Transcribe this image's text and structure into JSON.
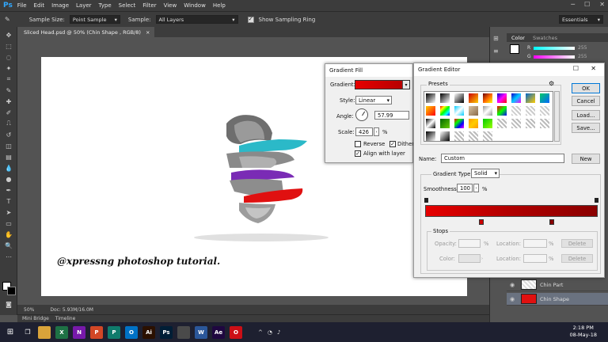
{
  "menubar": {
    "app_logo": "Ps",
    "items": [
      "File",
      "Edit",
      "Image",
      "Layer",
      "Type",
      "Select",
      "Filter",
      "View",
      "Window",
      "Help"
    ]
  },
  "options": {
    "sample_size_label": "Sample Size:",
    "sample_size_value": "Point Sample",
    "sample_label": "Sample:",
    "sample_value": "All Layers",
    "show_ring_label": "Show Sampling Ring",
    "workspace": "Essentials"
  },
  "document": {
    "tab_title": "Sliced Head.psd @ 50% (Chin Shape , RGB/8)",
    "zoom": "50%",
    "doc_info": "Doc: 5.93M/16.0M",
    "caption": "@xpressng photoshop tutorial."
  },
  "bottom_tabs": [
    "Mini Bridge",
    "Timeline"
  ],
  "panels": {
    "color_tab": "Color",
    "swatches_tab": "Swatches",
    "r_label": "R",
    "g_label": "G",
    "r_value": "255",
    "g_value": "255"
  },
  "layers": [
    {
      "name": "Chin Part"
    },
    {
      "name": "Chin Shape"
    }
  ],
  "gradient_fill": {
    "title": "Gradient Fill",
    "gradient_label": "Gradient:",
    "style_label": "Style:",
    "style_value": "Linear",
    "angle_label": "Angle:",
    "angle_value": "57.99",
    "scale_label": "Scale:",
    "scale_value": "426",
    "percent": "%",
    "reverse_label": "Reverse",
    "dither_label": "Dither",
    "align_label": "Align with layer",
    "reverse_checked": false,
    "dither_checked": true,
    "align_checked": true
  },
  "gradient_editor": {
    "title": "Gradient Editor",
    "presets_label": "Presets",
    "ok": "OK",
    "cancel": "Cancel",
    "load": "Load...",
    "save": "Save...",
    "name_label": "Name:",
    "name_value": "Custom",
    "new_button": "New",
    "type_label": "Gradient Type:",
    "type_value": "Solid",
    "smoothness_label": "Smoothness:",
    "smoothness_value": "100",
    "percent": "%",
    "stops_label": "Stops",
    "opacity_label": "Opacity:",
    "color_label": "Color:",
    "location_label": "Location:",
    "delete_label": "Delete",
    "gradient_colors": [
      "#e60000",
      "#b00000",
      "#8a0000"
    ]
  },
  "taskbar": {
    "time": "2:18 PM",
    "date": "08-May-18",
    "apps": [
      {
        "label": "",
        "color": "#d9a33a"
      },
      {
        "label": "X",
        "color": "#1e7145"
      },
      {
        "label": "N",
        "color": "#7719aa"
      },
      {
        "label": "P",
        "color": "#d24726"
      },
      {
        "label": "P",
        "color": "#0f7b6c"
      },
      {
        "label": "O",
        "color": "#0072c6"
      },
      {
        "label": "Ai",
        "color": "#2b1000"
      },
      {
        "label": "Ps",
        "color": "#001e36"
      },
      {
        "label": "",
        "color": "#4a4a4a"
      },
      {
        "label": "W",
        "color": "#2b579a"
      },
      {
        "label": "Ae",
        "color": "#1f0740"
      },
      {
        "label": "O",
        "color": "#cc0f16"
      }
    ]
  },
  "colors": {
    "accent_red": "#e01010",
    "ps_blue": "#31a8ff"
  }
}
